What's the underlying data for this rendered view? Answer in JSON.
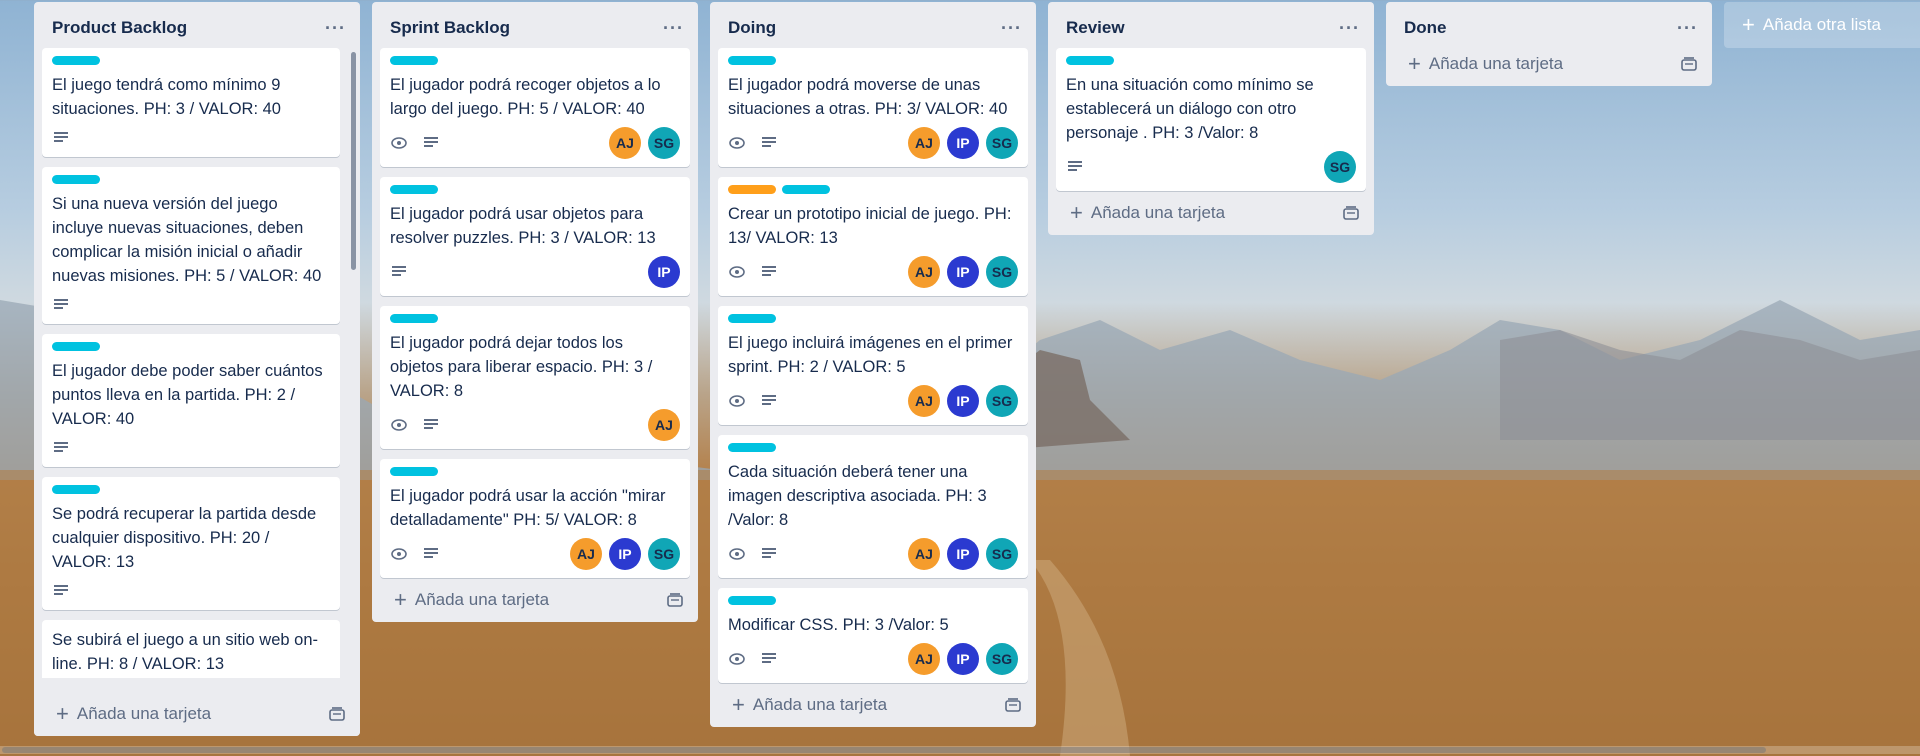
{
  "board": {
    "add_list_label": "Añada otra lista",
    "add_card_label": "Añada una tarjeta",
    "colors": {
      "label_cyan": "#00c2e0",
      "label_orange": "#ff9f1a",
      "AJ": "#f59c2c",
      "IP": "#2b3ad0",
      "SG": "#10a6b6"
    }
  },
  "lists": [
    {
      "title": "Product Backlog",
      "cards": [
        {
          "title": "El juego tendrá como mínimo 9 situaciones. PH: 3 / VALOR: 40"
        },
        {
          "title": "Si una nueva versión del juego incluye nuevas situaciones, deben complicar la misión inicial o añadir nuevas misiones. PH: 5 / VALOR: 40"
        },
        {
          "title": "El jugador debe poder saber cuántos puntos lleva en la partida. PH: 2 / VALOR: 40"
        },
        {
          "title": "Se podrá recuperar la partida desde cualquier dispositivo. PH: 20 / VALOR: 13"
        },
        {
          "title": "Se subirá el juego a un sitio web on-line. PH: 8 / VALOR: 13"
        }
      ]
    },
    {
      "title": "Sprint Backlog",
      "cards": [
        {
          "title": "El jugador podrá recoger objetos a lo largo del juego. PH: 5 / VALOR: 40",
          "members": [
            "AJ",
            "SG"
          ]
        },
        {
          "title": "El jugador podrá usar objetos para resolver puzzles. PH: 3 / VALOR: 13",
          "members": [
            "IP"
          ]
        },
        {
          "title": "El jugador podrá dejar todos los objetos para liberar espacio. PH: 3 / VALOR: 8",
          "members": [
            "AJ"
          ]
        },
        {
          "title": "El jugador podrá usar la acción \"mirar detalladamente\" PH: 5/ VALOR: 8",
          "members": [
            "AJ",
            "IP",
            "SG"
          ]
        }
      ]
    },
    {
      "title": "Doing",
      "cards": [
        {
          "title": "El jugador podrá moverse de unas situaciones a otras. PH: 3/ VALOR: 40",
          "members": [
            "AJ",
            "IP",
            "SG"
          ]
        },
        {
          "title": "Crear un prototipo inicial de juego. PH: 13/ VALOR: 13",
          "members": [
            "AJ",
            "IP",
            "SG"
          ]
        },
        {
          "title": "El juego incluirá imágenes en el primer sprint. PH: 2 / VALOR: 5",
          "members": [
            "AJ",
            "IP",
            "SG"
          ]
        },
        {
          "title": "Cada situación deberá tener una imagen descriptiva asociada. PH: 3 /Valor: 8",
          "members": [
            "AJ",
            "IP",
            "SG"
          ]
        },
        {
          "title": "Modificar CSS. PH: 3 /Valor: 5",
          "members": [
            "AJ",
            "IP",
            "SG"
          ]
        }
      ]
    },
    {
      "title": "Review",
      "cards": [
        {
          "title": "En una situación como mínimo se establecerá un diálogo con otro personaje . PH: 3 /Valor: 8",
          "members": [
            "SG"
          ]
        }
      ]
    },
    {
      "title": "Done",
      "cards": []
    }
  ]
}
